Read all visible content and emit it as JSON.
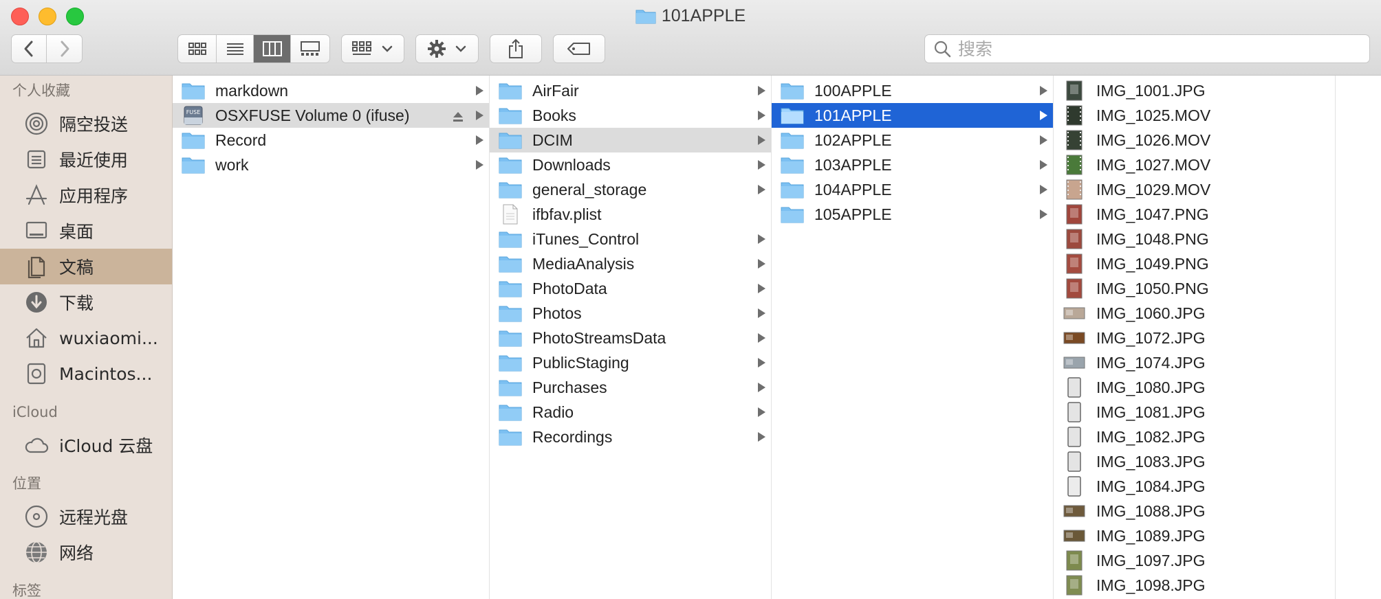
{
  "window": {
    "title": "101APPLE"
  },
  "toolbar": {
    "search_placeholder": "搜索"
  },
  "sidebar": {
    "sections": [
      {
        "title": "个人收藏",
        "items": [
          {
            "label": "隔空投送",
            "icon": "airdrop-icon"
          },
          {
            "label": "最近使用",
            "icon": "recents-icon"
          },
          {
            "label": "应用程序",
            "icon": "applications-icon"
          },
          {
            "label": "桌面",
            "icon": "desktop-icon"
          },
          {
            "label": "文稿",
            "icon": "documents-icon",
            "active": true
          },
          {
            "label": "下载",
            "icon": "downloads-icon"
          },
          {
            "label": "wuxiaomi...",
            "icon": "home-icon"
          },
          {
            "label": "Macintos...",
            "icon": "harddisk-icon"
          }
        ]
      },
      {
        "title": "iCloud",
        "items": [
          {
            "label": "iCloud 云盘",
            "icon": "cloud-icon"
          }
        ]
      },
      {
        "title": "位置",
        "items": [
          {
            "label": "远程光盘",
            "icon": "disc-icon"
          },
          {
            "label": "网络",
            "icon": "network-icon"
          }
        ]
      },
      {
        "title": "标签",
        "items": []
      }
    ]
  },
  "columns": [
    {
      "items": [
        {
          "name": "markdown",
          "type": "folder"
        },
        {
          "name": "OSXFUSE Volume 0 (ifuse)",
          "type": "drive",
          "selected": "gray"
        },
        {
          "name": "Record",
          "type": "folder"
        },
        {
          "name": "work",
          "type": "folder"
        }
      ]
    },
    {
      "items": [
        {
          "name": "AirFair",
          "type": "folder"
        },
        {
          "name": "Books",
          "type": "folder"
        },
        {
          "name": "DCIM",
          "type": "folder",
          "selected": "gray"
        },
        {
          "name": "Downloads",
          "type": "folder"
        },
        {
          "name": "general_storage",
          "type": "folder"
        },
        {
          "name": "ifbfav.plist",
          "type": "file"
        },
        {
          "name": "iTunes_Control",
          "type": "folder"
        },
        {
          "name": "MediaAnalysis",
          "type": "folder"
        },
        {
          "name": "PhotoData",
          "type": "folder"
        },
        {
          "name": "Photos",
          "type": "folder"
        },
        {
          "name": "PhotoStreamsData",
          "type": "folder"
        },
        {
          "name": "PublicStaging",
          "type": "folder"
        },
        {
          "name": "Purchases",
          "type": "folder"
        },
        {
          "name": "Radio",
          "type": "folder"
        },
        {
          "name": "Recordings",
          "type": "folder"
        }
      ]
    },
    {
      "items": [
        {
          "name": "100APPLE",
          "type": "folder"
        },
        {
          "name": "101APPLE",
          "type": "folder",
          "selected": "blue"
        },
        {
          "name": "102APPLE",
          "type": "folder"
        },
        {
          "name": "103APPLE",
          "type": "folder"
        },
        {
          "name": "104APPLE",
          "type": "folder"
        },
        {
          "name": "105APPLE",
          "type": "folder"
        }
      ]
    },
    {
      "items": [
        {
          "name": "IMG_1001.JPG",
          "type": "image",
          "color": "#3d4a3f"
        },
        {
          "name": "IMG_1025.MOV",
          "type": "video",
          "color": "#2f3a2e"
        },
        {
          "name": "IMG_1026.MOV",
          "type": "video",
          "color": "#364234"
        },
        {
          "name": "IMG_1027.MOV",
          "type": "video",
          "color": "#4a7a3a"
        },
        {
          "name": "IMG_1029.MOV",
          "type": "video",
          "color": "#c8a58f"
        },
        {
          "name": "IMG_1047.PNG",
          "type": "image",
          "color": "#a0463c"
        },
        {
          "name": "IMG_1048.PNG",
          "type": "image",
          "color": "#9c4a3e"
        },
        {
          "name": "IMG_1049.PNG",
          "type": "image",
          "color": "#a44c40"
        },
        {
          "name": "IMG_1050.PNG",
          "type": "image",
          "color": "#a24a3e"
        },
        {
          "name": "IMG_1060.JPG",
          "type": "image-landscape",
          "color": "#b9a898"
        },
        {
          "name": "IMG_1072.JPG",
          "type": "image-landscape",
          "color": "#7a4a24"
        },
        {
          "name": "IMG_1074.JPG",
          "type": "image-landscape",
          "color": "#9aa4ac"
        },
        {
          "name": "IMG_1080.JPG",
          "type": "phone",
          "color": "#e4e4e4"
        },
        {
          "name": "IMG_1081.JPG",
          "type": "phone",
          "color": "#e4e4e4"
        },
        {
          "name": "IMG_1082.JPG",
          "type": "phone",
          "color": "#e4e4e4"
        },
        {
          "name": "IMG_1083.JPG",
          "type": "phone",
          "color": "#e4e4e4"
        },
        {
          "name": "IMG_1084.JPG",
          "type": "phone",
          "color": "#ececec"
        },
        {
          "name": "IMG_1088.JPG",
          "type": "image-landscape",
          "color": "#6e5a3c"
        },
        {
          "name": "IMG_1089.JPG",
          "type": "image-landscape",
          "color": "#6a5838"
        },
        {
          "name": "IMG_1097.JPG",
          "type": "image",
          "color": "#7d8a4e"
        },
        {
          "name": "IMG_1098.JPG",
          "type": "image",
          "color": "#7f8c52"
        }
      ]
    }
  ],
  "colors": {
    "folder": "#7cc0f2",
    "selection_blue": "#1f64d6",
    "sidebar_bg": "#e9e0d9",
    "sidebar_active": "#cbb49b"
  }
}
